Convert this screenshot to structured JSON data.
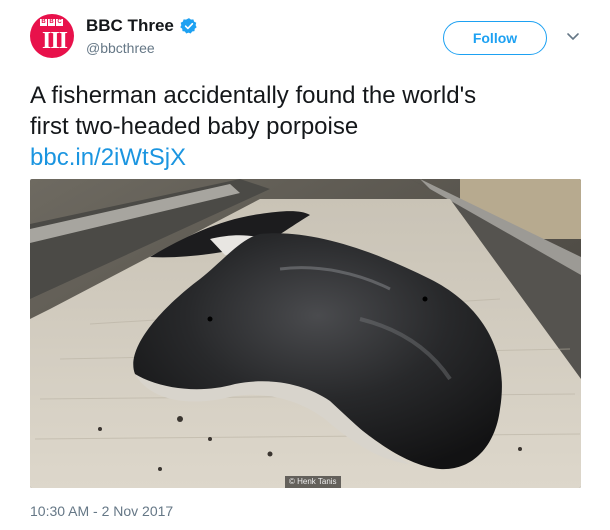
{
  "account": {
    "avatar_logo": "BBC",
    "avatar_text": "III",
    "display_name": "BBC Three",
    "handle": "@bbcthree",
    "verified_icon": "verified-badge-icon"
  },
  "actions": {
    "follow_label": "Follow",
    "menu_icon": "chevron-down-icon"
  },
  "tweet": {
    "text_line1": "A fisherman accidentally found the world's",
    "text_line2": "first two-headed baby porpoise",
    "link": "bbc.in/2iWtSjX",
    "timestamp": "10:30 AM - 2 Nov 2017"
  },
  "media": {
    "credit": "© Henk Tanis"
  },
  "colors": {
    "accent": "#1da1f2",
    "link": "#1b95e0",
    "brand": "#e8114b",
    "text_secondary": "#657786"
  }
}
